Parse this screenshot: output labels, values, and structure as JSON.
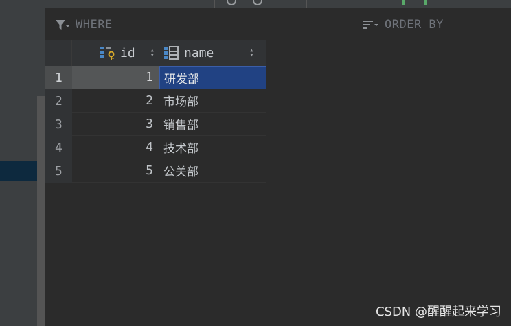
{
  "filter": {
    "where_label": "WHERE",
    "order_label": "ORDER BY"
  },
  "table": {
    "columns": [
      {
        "label": "id",
        "icon": "primary-key-column-icon"
      },
      {
        "label": "name",
        "icon": "column-icon"
      }
    ],
    "rows": [
      {
        "num": "1",
        "id": "1",
        "name": "研发部"
      },
      {
        "num": "2",
        "id": "2",
        "name": "市场部"
      },
      {
        "num": "3",
        "id": "3",
        "name": "销售部"
      },
      {
        "num": "4",
        "id": "4",
        "name": "技术部"
      },
      {
        "num": "5",
        "id": "5",
        "name": "公关部"
      }
    ],
    "selected_row": 1,
    "selected_column": "name"
  },
  "watermark": "CSDN @醒醒起来学习",
  "colors": {
    "background": "#2b2b2b",
    "selection": "#214283",
    "gutter": "#313335"
  }
}
